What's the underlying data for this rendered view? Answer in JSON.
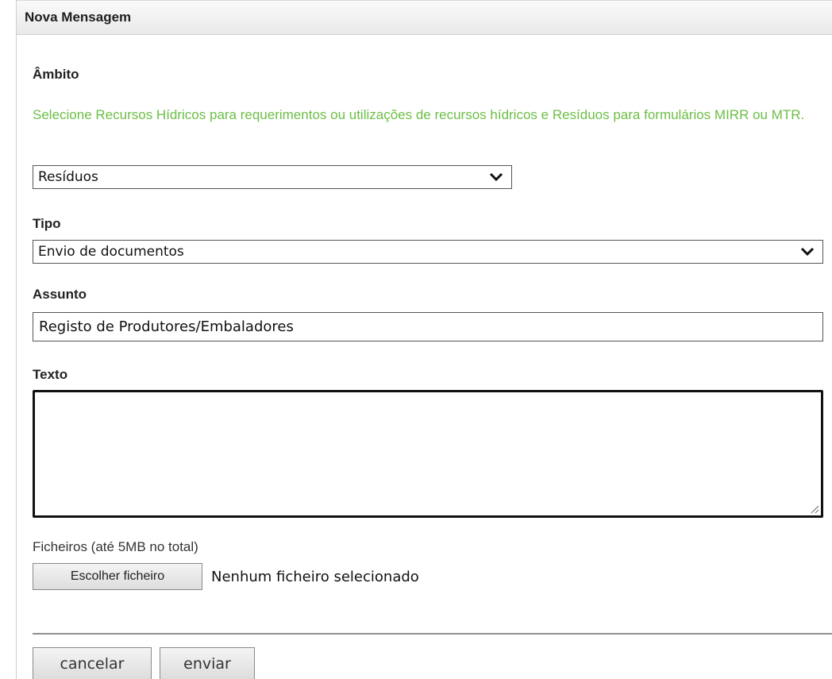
{
  "panel": {
    "title": "Nova Mensagem"
  },
  "ambito": {
    "label": "Âmbito",
    "hint": "Selecione Recursos Hídricos para requerimentos ou utilizações de recursos hídricos e Resíduos para formulários MIRR ou MTR.",
    "selected": "Resíduos"
  },
  "tipo": {
    "label": "Tipo",
    "selected": "Envio de documentos"
  },
  "assunto": {
    "label": "Assunto",
    "value": "Registo de Produtores/Embaladores"
  },
  "texto": {
    "label": "Texto",
    "value": ""
  },
  "ficheiros": {
    "label": "Ficheiros (até 5MB no total)",
    "button_label": "Escolher ficheiro",
    "status": "Nenhum ficheiro selecionado"
  },
  "actions": {
    "cancel_label": "cancelar",
    "send_label": "enviar"
  },
  "colors": {
    "hint_text": "#6cbe45",
    "header_bg": "#ececec"
  },
  "icons": {
    "dropdown": "chevron-down-icon",
    "resize": "resize-grip-icon"
  }
}
